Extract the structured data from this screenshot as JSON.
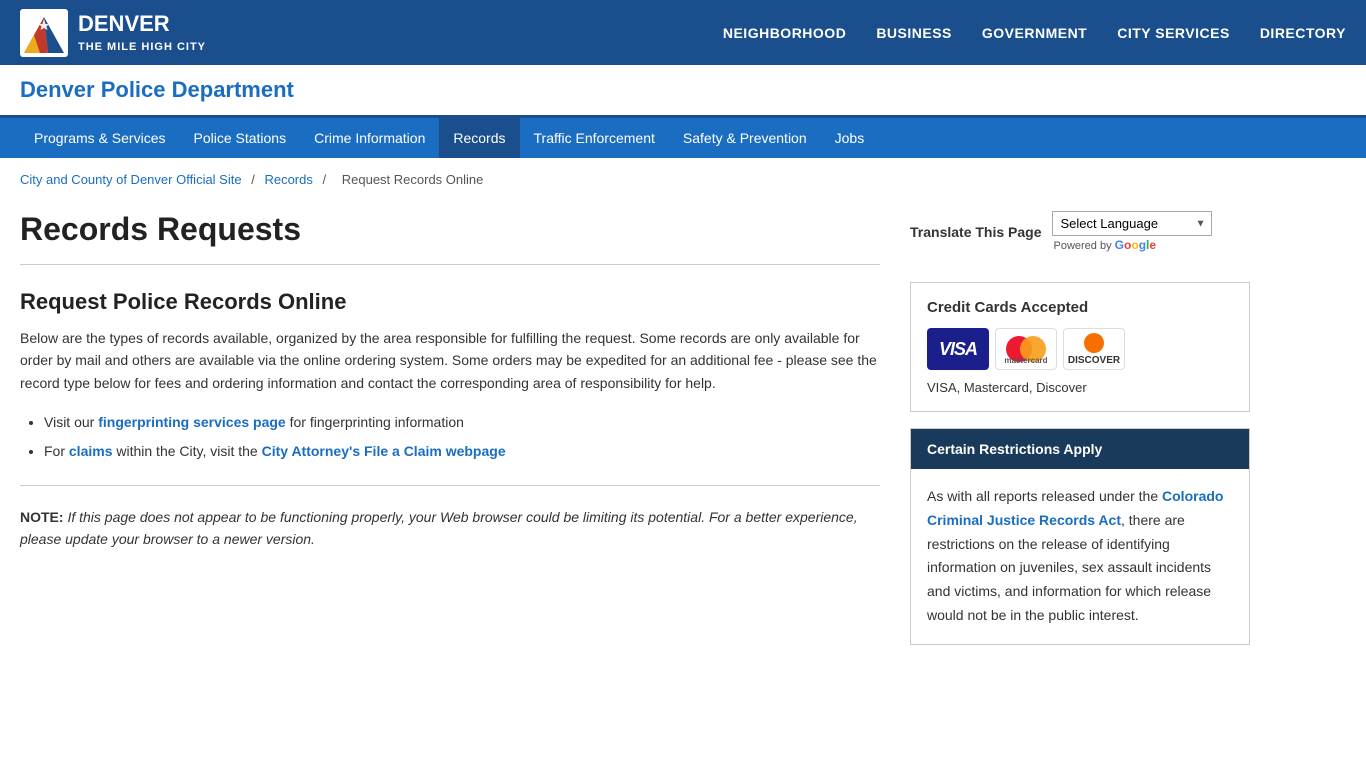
{
  "topNav": {
    "logoLine1": "DENVER",
    "logoLine2": "THE MILE HIGH CITY",
    "navItems": [
      {
        "label": "NEIGHBORHOOD",
        "href": "#"
      },
      {
        "label": "BUSINESS",
        "href": "#"
      },
      {
        "label": "GOVERNMENT",
        "href": "#"
      },
      {
        "label": "CITY SERVICES",
        "href": "#"
      },
      {
        "label": "DIRECTORY",
        "href": "#"
      }
    ]
  },
  "deptHeader": {
    "title": "Denver Police Department"
  },
  "subNav": {
    "items": [
      {
        "label": "Programs & Services",
        "href": "#",
        "active": false
      },
      {
        "label": "Police Stations",
        "href": "#",
        "active": false
      },
      {
        "label": "Crime Information",
        "href": "#",
        "active": false
      },
      {
        "label": "Records",
        "href": "#",
        "active": true
      },
      {
        "label": "Traffic Enforcement",
        "href": "#",
        "active": false
      },
      {
        "label": "Safety & Prevention",
        "href": "#",
        "active": false
      },
      {
        "label": "Jobs",
        "href": "#",
        "active": false
      }
    ]
  },
  "breadcrumb": {
    "item1": "City and County of Denver Official Site",
    "item2": "Records",
    "item3": "Request Records Online"
  },
  "page": {
    "title": "Records Requests",
    "sectionHeading": "Request Police Records Online",
    "bodyText": "Below are the types of records available, organized by the area responsible for fulfilling the request.  Some records are only available for order by mail and others are available via the online ordering system.  Some orders may be expedited for an additional fee - please see the record type below for fees and ordering information and contact the corresponding area of responsibility for help.",
    "bullet1Prefix": "Visit our ",
    "bullet1Link": "fingerprinting services page",
    "bullet1Suffix": " for fingerprinting information",
    "bullet2Prefix": "For ",
    "bullet2Link1": "claims",
    "bullet2Middle": " within the City, visit the ",
    "bullet2Link2": "City Attorney's File a Claim webpage",
    "noteLabel": "NOTE:",
    "noteText": " If this page does not appear to be functioning properly, your Web browser could be limiting its potential.  For a better experience, please update your browser to a newer version."
  },
  "sidebar": {
    "translateLabel": "Translate This Page",
    "selectLanguagePlaceholder": "Select Language",
    "poweredByText": "Powered by ",
    "googleText": "Google",
    "creditCards": {
      "heading": "Credit Cards Accepted",
      "cardNames": "VISA, Mastercard, Discover",
      "visa": "VISA",
      "mastercard": "mastercard",
      "discover": "DISCOVER"
    },
    "restrictions": {
      "heading": "Certain Restrictions Apply",
      "linkText": "Colorado Criminal Justice Records Act",
      "bodyText1": "As with all reports released under the ",
      "bodyText2": ", there are restrictions on the release of identifying information on juveniles, sex assault incidents and victims, and information for which release would not be in the public interest."
    }
  }
}
